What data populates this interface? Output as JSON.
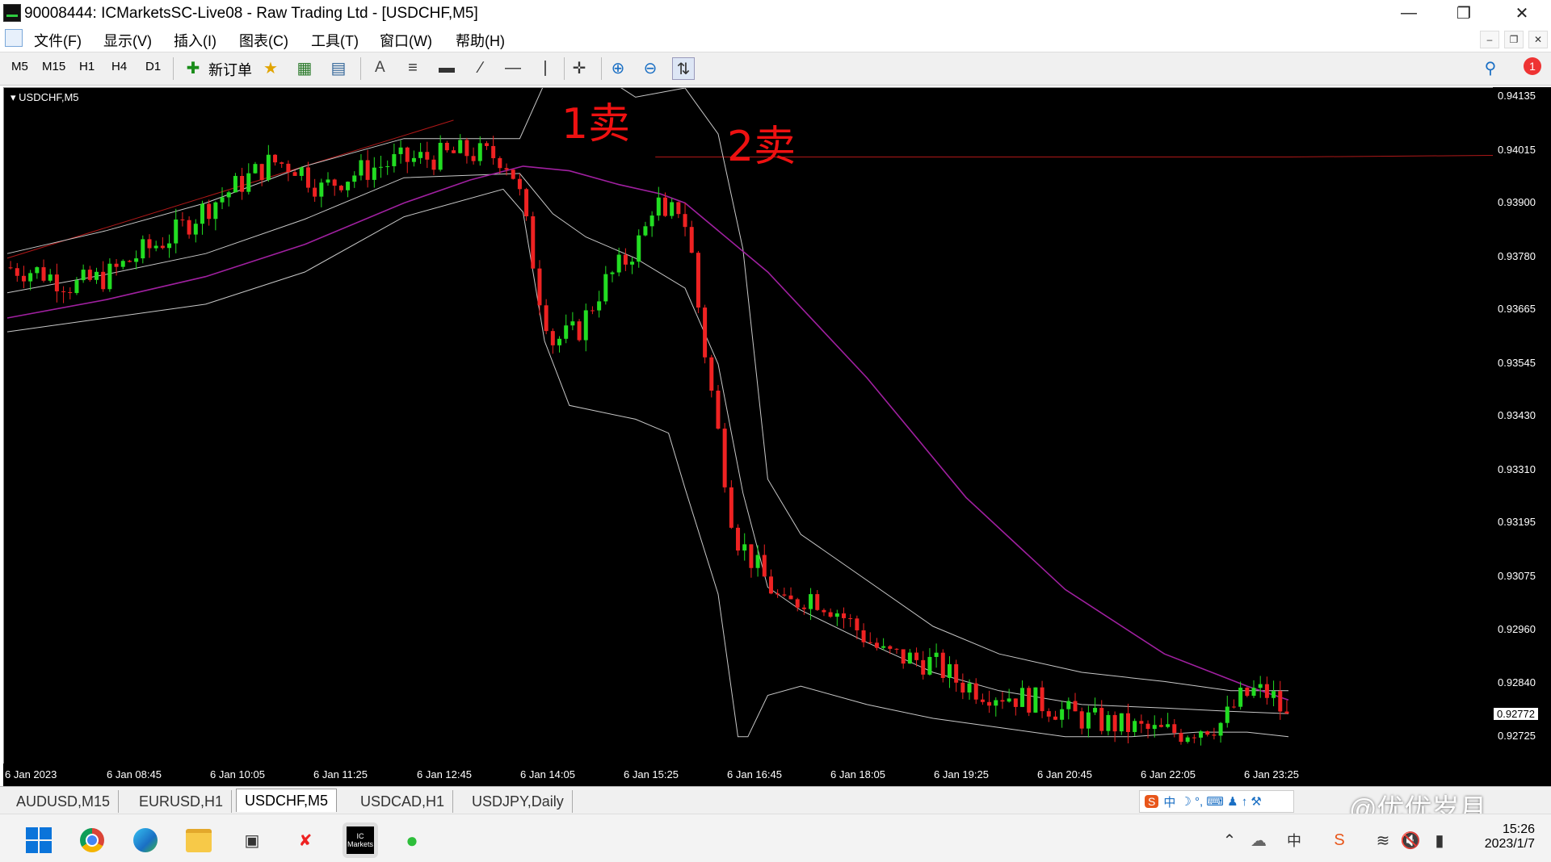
{
  "window": {
    "title": "90008444: ICMarketsSC-Live08 - Raw Trading Ltd - [USDCHF,M5]"
  },
  "menu": [
    "文件(F)",
    "显示(V)",
    "插入(I)",
    "图表(C)",
    "工具(T)",
    "窗口(W)",
    "帮助(H)"
  ],
  "toolbar": {
    "timeframes": [
      "M5",
      "M15",
      "H1",
      "H4",
      "D1"
    ],
    "new_order_label": "新订单",
    "text_tool_label": "A",
    "alert_badge": "1"
  },
  "chart": {
    "symbol_label": "USDCHF,M5",
    "annotations": [
      "1卖",
      "2卖"
    ],
    "price_labels": [
      "0.94135",
      "0.94015",
      "0.93900",
      "0.93780",
      "0.93665",
      "0.93545",
      "0.93430",
      "0.93310",
      "0.93195",
      "0.93075",
      "0.92960",
      "0.92840",
      "0.92772",
      "0.92725"
    ],
    "current_price": "0.92772",
    "time_labels": [
      "6 Jan 2023",
      "6 Jan 08:45",
      "6 Jan 10:05",
      "6 Jan 11:25",
      "6 Jan 12:45",
      "6 Jan 14:05",
      "6 Jan 15:25",
      "6 Jan 16:45",
      "6 Jan 18:05",
      "6 Jan 19:25",
      "6 Jan 20:45",
      "6 Jan 22:05",
      "6 Jan 23:25"
    ],
    "colors": {
      "bull": "#22dd22",
      "bear": "#ee2222",
      "ma": "#a020a0",
      "bands": "#c8c8c8",
      "background": "#000000"
    }
  },
  "chart_data": {
    "type": "candlestick",
    "symbol": "USDCHF",
    "timeframe": "M5",
    "x_ticks": [
      "6 Jan 2023",
      "6 Jan 08:45",
      "6 Jan 10:05",
      "6 Jan 11:25",
      "6 Jan 12:45",
      "6 Jan 14:05",
      "6 Jan 15:25",
      "6 Jan 16:45",
      "6 Jan 18:05",
      "6 Jan 19:25",
      "6 Jan 20:45",
      "6 Jan 22:05",
      "6 Jan 23:25"
    ],
    "y_ticks": [
      0.94135,
      0.94015,
      0.939,
      0.9378,
      0.93665,
      0.93545,
      0.9343,
      0.9331,
      0.93195,
      0.93075,
      0.9296,
      0.9284,
      0.92725
    ],
    "ylim": [
      0.9268,
      0.9415
    ],
    "current_price": 0.92772,
    "close_path": [
      [
        0,
        0.9376
      ],
      [
        20,
        0.9375
      ],
      [
        40,
        0.9372
      ],
      [
        60,
        0.9374
      ],
      [
        80,
        0.9379
      ],
      [
        100,
        0.9383
      ],
      [
        120,
        0.9389
      ],
      [
        140,
        0.9394
      ],
      [
        160,
        0.9399
      ],
      [
        175,
        0.9398
      ],
      [
        190,
        0.9393
      ],
      [
        200,
        0.9395
      ],
      [
        215,
        0.9397
      ],
      [
        235,
        0.9399
      ],
      [
        260,
        0.94
      ],
      [
        275,
        0.9401
      ],
      [
        300,
        0.94
      ],
      [
        308,
        0.9395
      ],
      [
        315,
        0.9383
      ],
      [
        322,
        0.937
      ],
      [
        330,
        0.936
      ],
      [
        345,
        0.9362
      ],
      [
        360,
        0.9372
      ],
      [
        375,
        0.9378
      ],
      [
        385,
        0.9383
      ],
      [
        392,
        0.9392
      ],
      [
        398,
        0.9385
      ],
      [
        405,
        0.939
      ],
      [
        412,
        0.9384
      ],
      [
        420,
        0.9362
      ],
      [
        430,
        0.934
      ],
      [
        440,
        0.9318
      ],
      [
        455,
        0.931
      ],
      [
        470,
        0.9302
      ],
      [
        485,
        0.9305
      ],
      [
        500,
        0.9302
      ],
      [
        515,
        0.9297
      ],
      [
        530,
        0.9292
      ],
      [
        545,
        0.9291
      ],
      [
        560,
        0.929
      ],
      [
        575,
        0.9286
      ],
      [
        590,
        0.9284
      ],
      [
        605,
        0.9283
      ],
      [
        620,
        0.9282
      ],
      [
        635,
        0.928
      ],
      [
        650,
        0.9278
      ],
      [
        665,
        0.9277
      ],
      [
        680,
        0.9276
      ],
      [
        695,
        0.9275
      ],
      [
        710,
        0.9275
      ],
      [
        720,
        0.9276
      ],
      [
        735,
        0.9277
      ],
      [
        745,
        0.9282
      ],
      [
        755,
        0.9284
      ],
      [
        765,
        0.9283
      ],
      [
        775,
        0.92772
      ]
    ],
    "ma_path": [
      [
        0,
        0.9365
      ],
      [
        60,
        0.9369
      ],
      [
        120,
        0.9374
      ],
      [
        180,
        0.9381
      ],
      [
        240,
        0.939
      ],
      [
        280,
        0.9395
      ],
      [
        312,
        0.9398
      ],
      [
        340,
        0.9397
      ],
      [
        370,
        0.9394
      ],
      [
        395,
        0.9392
      ],
      [
        410,
        0.939
      ],
      [
        460,
        0.9375
      ],
      [
        520,
        0.9352
      ],
      [
        580,
        0.9326
      ],
      [
        640,
        0.9306
      ],
      [
        700,
        0.9292
      ],
      [
        750,
        0.9285
      ],
      [
        775,
        0.9282
      ]
    ],
    "upper_band": [
      [
        0,
        0.9379
      ],
      [
        60,
        0.9384
      ],
      [
        120,
        0.939
      ],
      [
        180,
        0.9398
      ],
      [
        240,
        0.9404
      ],
      [
        310,
        0.9404
      ],
      [
        330,
        0.942
      ],
      [
        350,
        0.942
      ],
      [
        380,
        0.9413
      ],
      [
        410,
        0.9415
      ],
      [
        430,
        0.9405
      ],
      [
        445,
        0.938
      ],
      [
        460,
        0.933
      ],
      [
        480,
        0.9318
      ],
      [
        520,
        0.9308
      ],
      [
        560,
        0.9298
      ],
      [
        600,
        0.9292
      ],
      [
        650,
        0.9288
      ],
      [
        700,
        0.9286
      ],
      [
        740,
        0.9284
      ],
      [
        775,
        0.9284
      ]
    ],
    "lower_band": [
      [
        0,
        0.9362
      ],
      [
        60,
        0.9365
      ],
      [
        120,
        0.9368
      ],
      [
        180,
        0.9375
      ],
      [
        240,
        0.9387
      ],
      [
        300,
        0.9393
      ],
      [
        312,
        0.9388
      ],
      [
        325,
        0.936
      ],
      [
        340,
        0.9346
      ],
      [
        380,
        0.9343
      ],
      [
        400,
        0.934
      ],
      [
        410,
        0.9328
      ],
      [
        430,
        0.9305
      ],
      [
        442,
        0.9274
      ],
      [
        448,
        0.9274
      ],
      [
        460,
        0.9283
      ],
      [
        480,
        0.9285
      ],
      [
        520,
        0.9281
      ],
      [
        560,
        0.9278
      ],
      [
        600,
        0.9276
      ],
      [
        640,
        0.9274
      ],
      [
        680,
        0.9274
      ],
      [
        720,
        0.9275
      ],
      [
        750,
        0.9275
      ],
      [
        775,
        0.9274
      ]
    ],
    "resistance_line": {
      "from_x": 392,
      "to_x": 775,
      "price": 0.94
    },
    "trend_line": [
      [
        0,
        0.9378
      ],
      [
        270,
        0.9408
      ]
    ],
    "notes": [
      "1卖",
      "2卖"
    ]
  },
  "tabs": [
    {
      "label": "AUDUSD,M15",
      "active": false
    },
    {
      "label": "EURUSD,H1",
      "active": false
    },
    {
      "label": "USDCHF,M5",
      "active": true
    },
    {
      "label": "USDCAD,H1",
      "active": false
    },
    {
      "label": "USDJPY,Daily",
      "active": false
    }
  ],
  "ime": {
    "label": "中",
    "watermark": "@优优岁月"
  },
  "taskbar": {
    "tray_lang": "中",
    "time": "15:26",
    "date": "2023/1/7",
    "mt_label": "IC Markets"
  }
}
